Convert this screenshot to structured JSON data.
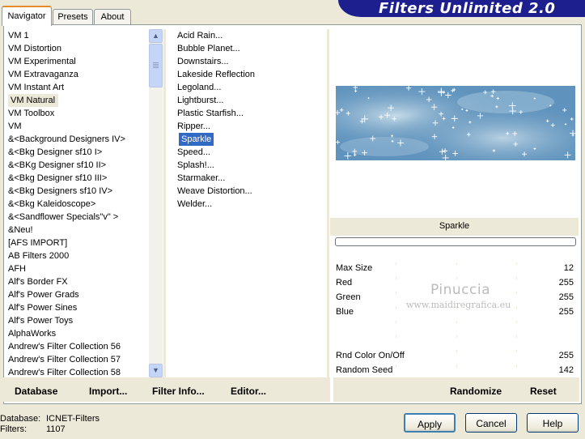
{
  "app_title": "Filters Unlimited 2.0",
  "tabs": [
    {
      "label": "Navigator",
      "active": true
    },
    {
      "label": "Presets",
      "active": false
    },
    {
      "label": "About",
      "active": false
    }
  ],
  "categories": [
    "VM 1",
    "VM Distortion",
    "VM Experimental",
    "VM Extravaganza",
    "VM Instant Art",
    "VM Natural",
    "VM Toolbox",
    "VM",
    "&<Background Designers IV>",
    "&<Bkg Designer sf10 I>",
    "&<BKg Designer sf10 II>",
    "&<Bkg Designer sf10 III>",
    "&<Bkg Designers sf10 IV>",
    "&<Bkg Kaleidoscope>",
    "&<Sandflower Specials\"v\" >",
    "&Neu!",
    "[AFS IMPORT]",
    "AB Filters 2000",
    "AFH",
    "Alf's Border FX",
    "Alf's Power Grads",
    "Alf's Power Sines",
    "Alf's Power Toys",
    "AlphaWorks",
    "Andrew's Filter Collection 56",
    "Andrew's Filter Collection 57",
    "Andrew's Filter Collection 58"
  ],
  "selected_category": "VM Natural",
  "filters": [
    "Acid Rain...",
    "Bubble Planet...",
    "Downstairs...",
    "Lakeside Reflection",
    "Legoland...",
    "Lightburst...",
    "Plastic Starfish...",
    "Ripper...",
    "Sparkle",
    "Speed...",
    "Splash!...",
    "Starmaker...",
    "Weave Distortion...",
    "Welder..."
  ],
  "selected_filter": "Sparkle",
  "preview_title": "Sparkle",
  "params": [
    {
      "name": "Max Size",
      "value": "12"
    },
    {
      "name": "Red",
      "value": "255"
    },
    {
      "name": "Green",
      "value": "255"
    },
    {
      "name": "Blue",
      "value": "255"
    },
    {
      "name": "",
      "value": ""
    },
    {
      "name": "",
      "value": ""
    },
    {
      "name": "Rnd Color On/Off",
      "value": "255"
    },
    {
      "name": "Random Seed",
      "value": "142"
    }
  ],
  "watermark": {
    "name": "Pinuccia",
    "url": "www.maidiregrafica.eu"
  },
  "toolbar": {
    "database": "Database",
    "import": "Import...",
    "filter_info": "Filter Info...",
    "editor": "Editor...",
    "randomize": "Randomize",
    "reset": "Reset"
  },
  "status": {
    "database_label": "Database:",
    "database_value": "ICNET-Filters",
    "filters_label": "Filters:",
    "filters_value": "1107"
  },
  "buttons": {
    "apply": "Apply",
    "cancel": "Cancel",
    "help": "Help"
  },
  "colors": {
    "title_banner": "#1d1f8f",
    "selection": "#316ac5",
    "preview_sky": "#5a8db8"
  },
  "icons": {
    "scroll_up": "scroll-up-arrow-icon",
    "scroll_down": "scroll-down-arrow-icon"
  }
}
